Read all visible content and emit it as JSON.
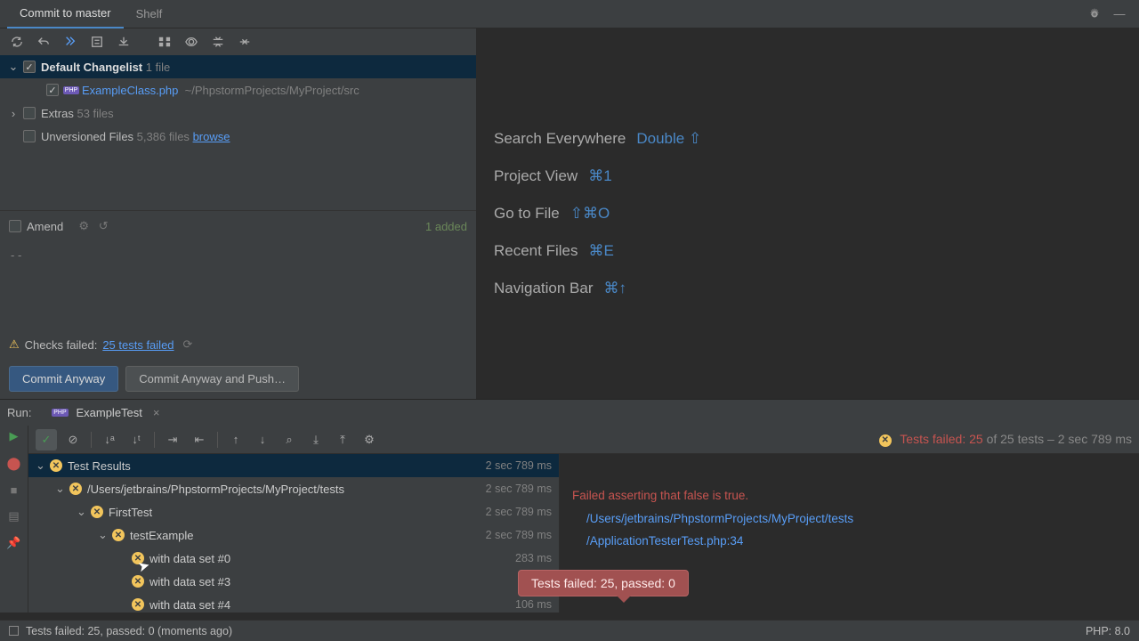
{
  "tabs": {
    "commit": "Commit to master",
    "shelf": "Shelf"
  },
  "changelist": {
    "default_label": "Default Changelist",
    "default_count": "1 file",
    "file_name": "ExampleClass.php",
    "file_path": "~/PhpstormProjects/MyProject/src",
    "extras_label": "Extras",
    "extras_count": "53 files",
    "unversioned_label": "Unversioned Files",
    "unversioned_count": "5,386 files",
    "browse": "browse"
  },
  "amend": {
    "label": "Amend",
    "added": "1 added"
  },
  "msg_placeholder": "- -",
  "checks": {
    "label": "Checks failed:",
    "link": "25 tests failed"
  },
  "buttons": {
    "commit_anyway": "Commit Anyway",
    "commit_push": "Commit Anyway and Push…"
  },
  "nav": {
    "search": "Search Everywhere",
    "search_k": "Double ⇧",
    "project": "Project View",
    "project_k": "⌘1",
    "goto": "Go to File",
    "goto_k": "⇧⌘O",
    "recent": "Recent Files",
    "recent_k": "⌘E",
    "navbar": "Navigation Bar",
    "navbar_k": "⌘↑"
  },
  "run": {
    "label": "Run:",
    "config": "ExampleTest",
    "summary_fail": "Tests failed: 25",
    "summary_rest": " of 25 tests – 2 sec 789 ms"
  },
  "tree": {
    "root": "Test Results",
    "root_t": "2 sec 789 ms",
    "path": "/Users/jetbrains/PhpstormProjects/MyProject/tests",
    "path_t": "2 sec 789 ms",
    "cls": "FirstTest",
    "cls_t": "2 sec 789 ms",
    "method": "testExample",
    "method_t": "2 sec 789 ms",
    "d0": "with data set #0",
    "d0_t": "283 ms",
    "d3": "with data set #3",
    "d3_t": "",
    "d4": "with data set #4",
    "d4_t": "106 ms"
  },
  "output": {
    "err": "Failed asserting that false is true.",
    "p1": "/Users/jetbrains/PhpstormProjects/MyProject/tests",
    "p2": "/ApplicationTesterTest.php:34"
  },
  "tooltip": "Tests failed: 25, passed: 0",
  "status": {
    "left": "Tests failed: 25, passed: 0 (moments ago)",
    "right": "PHP: 8.0"
  }
}
